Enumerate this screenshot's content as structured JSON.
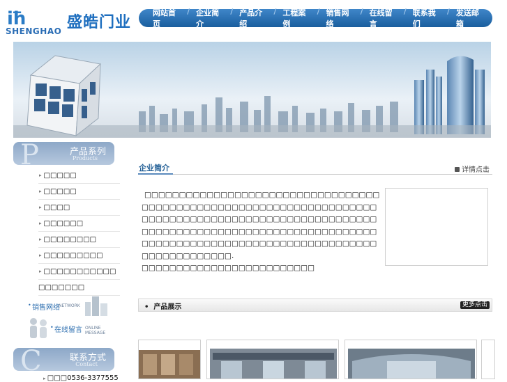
{
  "logo": {
    "mark": "iħ",
    "cn": "盛皓门业",
    "en": "SHENGHAO"
  },
  "nav": [
    "网站首页",
    "企业简介",
    "产品介绍",
    "工程案例",
    "销售网络",
    "在线留言",
    "联系我们",
    "发送邮箱"
  ],
  "sidebar": {
    "products_head": {
      "big": "P",
      "cn": "产品系列",
      "en": "Products"
    },
    "products": [
      "□□□□□",
      "□□□□□",
      "□□□□",
      "□□□□□□",
      "□□□□□□□□",
      "□□□□□□□□□",
      "□□□□□□□□□□□",
      "□□□□□□□"
    ],
    "network": {
      "cn": "销售网络",
      "en": "NETWORK"
    },
    "message": {
      "cn": "在线留言",
      "en": "ONLINE MESSAGE"
    },
    "contact_head": {
      "big": "C",
      "cn": "联系方式",
      "en": "Contact"
    },
    "contact_line": "□□□0536-3377555"
  },
  "intro": {
    "title": "企业简介",
    "more": "详情点击",
    "paragraph": "□□□□□□□□□□□□□□□□□□□□□□□□□□□□□□□□□□□□□□□□□□□□□□□□□□□□□□□□□□□□□□□□□□□□□□□□□□□□□□□□□□□□□□□□□□□□□□□□□□□□□□□□□□□□□□□□□□□□□□□□□□□□□□□□□□□□□□□□□□□□□□□□□□□□□□□□□□□□□□□□□□□□□□□□□□□□□□□□□□□□□□□.",
    "paragraph2": "□□□□□□□□□□□□□□□□□□□□□□□□□"
  },
  "products_section": {
    "title": "产品展示",
    "bullet": "•",
    "more": "更多点击"
  }
}
